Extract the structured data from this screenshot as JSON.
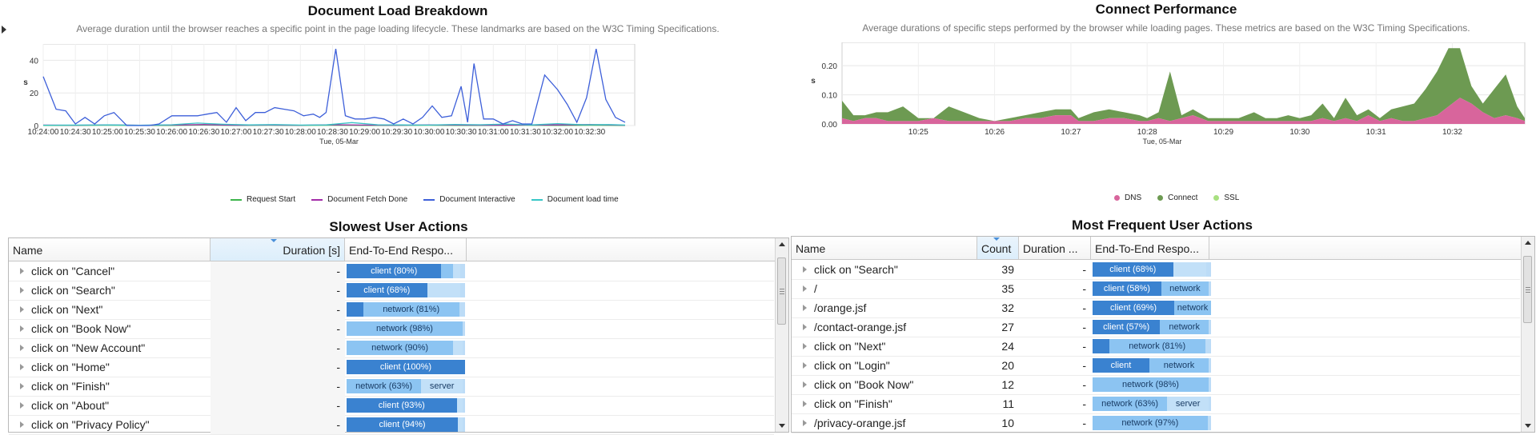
{
  "colors": {
    "request_start": "#3cb44b",
    "document_fetch_done": "#a32ca8",
    "document_interactive": "#3d5fd9",
    "document_load_time": "#37c6c6",
    "dns": "#d8659c",
    "connect": "#6d9a52",
    "ssl": "#a8e080",
    "bar_dark": "#3a82d0",
    "bar_mid": "#8cc4f2"
  },
  "panels": {
    "load": {
      "title": "Document Load Breakdown",
      "subtitle": "Average duration until the browser reaches a specific point in the page loading lifecycle. These landmarks are based on the W3C Timing Specifications.",
      "legend": [
        "Request Start",
        "Document Fetch Done",
        "Document Interactive",
        "Document load time"
      ]
    },
    "connect": {
      "title": "Connect Performance",
      "subtitle": "Average durations of specific steps performed by the browser while loading pages. These metrics are based on the W3C Timing Specifications.",
      "legend": [
        "DNS",
        "Connect",
        "SSL"
      ]
    },
    "slowest": {
      "title": "Slowest User Actions",
      "columns": [
        "Name",
        "Duration [s]",
        "End-To-End Respo..."
      ],
      "rows": [
        {
          "name": "click on \"Cancel\"",
          "duration": "-",
          "segs": [
            {
              "label": "client (80%)",
              "pct": 80,
              "tone": "dark"
            },
            {
              "label": "",
              "pct": 10,
              "tone": "mid"
            },
            {
              "label": "",
              "pct": 6,
              "tone": "light"
            }
          ]
        },
        {
          "name": "click on \"Search\"",
          "duration": "-",
          "segs": [
            {
              "label": "client (68%)",
              "pct": 68,
              "tone": "dark"
            },
            {
              "label": "",
              "pct": 28,
              "tone": "light"
            }
          ]
        },
        {
          "name": "click on \"Next\"",
          "duration": "-",
          "segs": [
            {
              "label": "",
              "pct": 14,
              "tone": "dark"
            },
            {
              "label": "network (81%)",
              "pct": 81,
              "tone": "mid"
            }
          ]
        },
        {
          "name": "click on \"Book Now\"",
          "duration": "-",
          "segs": [
            {
              "label": "network (98%)",
              "pct": 98,
              "tone": "mid"
            }
          ]
        },
        {
          "name": "click on \"New Account\"",
          "duration": "-",
          "segs": [
            {
              "label": "network (90%)",
              "pct": 90,
              "tone": "mid"
            },
            {
              "label": "",
              "pct": 8,
              "tone": "light"
            }
          ]
        },
        {
          "name": "click on \"Home\"",
          "duration": "-",
          "segs": [
            {
              "label": "client (100%)",
              "pct": 100,
              "tone": "dark"
            }
          ]
        },
        {
          "name": "click on \"Finish\"",
          "duration": "-",
          "segs": [
            {
              "label": "network (63%)",
              "pct": 63,
              "tone": "mid"
            },
            {
              "label": "server",
              "pct": 35,
              "tone": "light"
            }
          ]
        },
        {
          "name": "click on \"About\"",
          "duration": "-",
          "segs": [
            {
              "label": "client (93%)",
              "pct": 93,
              "tone": "dark"
            },
            {
              "label": "",
              "pct": 5,
              "tone": "light"
            }
          ]
        },
        {
          "name": "click on \"Privacy Policy\"",
          "duration": "-",
          "segs": [
            {
              "label": "client (94%)",
              "pct": 94,
              "tone": "dark"
            },
            {
              "label": "",
              "pct": 4,
              "tone": "light"
            }
          ]
        }
      ]
    },
    "frequent": {
      "title": "Most Frequent User Actions",
      "columns": [
        "Name",
        "Count",
        "Duration ...",
        "End-To-End Respo..."
      ],
      "rows": [
        {
          "name": "click on \"Search\"",
          "count": "39",
          "duration": "-",
          "segs": [
            {
              "label": "client (68%)",
              "pct": 68,
              "tone": "dark"
            },
            {
              "label": "",
              "pct": 28,
              "tone": "light"
            }
          ]
        },
        {
          "name": "/",
          "count": "35",
          "duration": "-",
          "segs": [
            {
              "label": "client (58%)",
              "pct": 58,
              "tone": "dark"
            },
            {
              "label": "network",
              "pct": 40,
              "tone": "mid"
            }
          ]
        },
        {
          "name": "/orange.jsf",
          "count": "32",
          "duration": "-",
          "segs": [
            {
              "label": "client (69%)",
              "pct": 69,
              "tone": "dark"
            },
            {
              "label": "network",
              "pct": 31,
              "tone": "mid"
            }
          ]
        },
        {
          "name": "/contact-orange.jsf",
          "count": "27",
          "duration": "-",
          "segs": [
            {
              "label": "client (57%)",
              "pct": 57,
              "tone": "dark"
            },
            {
              "label": "network",
              "pct": 41,
              "tone": "mid"
            }
          ]
        },
        {
          "name": "click on \"Next\"",
          "count": "24",
          "duration": "-",
          "segs": [
            {
              "label": "",
              "pct": 14,
              "tone": "dark"
            },
            {
              "label": "network (81%)",
              "pct": 81,
              "tone": "mid"
            }
          ]
        },
        {
          "name": "click on \"Login\"",
          "count": "20",
          "duration": "-",
          "segs": [
            {
              "label": "client",
              "pct": 48,
              "tone": "dark"
            },
            {
              "label": "network",
              "pct": 50,
              "tone": "mid"
            }
          ]
        },
        {
          "name": "click on \"Book Now\"",
          "count": "12",
          "duration": "-",
          "segs": [
            {
              "label": "network (98%)",
              "pct": 98,
              "tone": "mid"
            }
          ]
        },
        {
          "name": "click on \"Finish\"",
          "count": "11",
          "duration": "-",
          "segs": [
            {
              "label": "network (63%)",
              "pct": 63,
              "tone": "mid"
            },
            {
              "label": "server",
              "pct": 35,
              "tone": "light"
            }
          ]
        },
        {
          "name": "/privacy-orange.jsf",
          "count": "10",
          "duration": "-",
          "segs": [
            {
              "label": "network (97%)",
              "pct": 97,
              "tone": "mid"
            }
          ]
        }
      ]
    }
  },
  "chart_data": [
    {
      "type": "line",
      "title": "Document Load Breakdown",
      "xlabel": "Tue, 05-Mar",
      "ylabel": "s",
      "ylim": [
        0,
        50
      ],
      "yticks": [
        0,
        20,
        40
      ],
      "xticks": [
        "10:24:00",
        "10:24:30",
        "10:25:00",
        "10:25:30",
        "10:26:00",
        "10:26:30",
        "10:27:00",
        "10:27:30",
        "10:28:00",
        "10:28:30",
        "10:29:00",
        "10:29:30",
        "10:30:00",
        "10:30:30",
        "10:31:00",
        "10:31:30",
        "10:32:00",
        "10:32:30"
      ],
      "xlim_minutes": [
        24,
        33.2
      ],
      "grid": true,
      "legend_position": "bottom",
      "series": [
        {
          "name": "Document Interactive",
          "color_key": "document_interactive",
          "x": [
            24.0,
            24.2,
            24.35,
            24.5,
            24.65,
            24.8,
            24.95,
            25.1,
            25.3,
            25.5,
            25.65,
            25.8,
            26.0,
            26.2,
            26.4,
            26.55,
            26.7,
            26.85,
            27.0,
            27.15,
            27.3,
            27.45,
            27.6,
            27.75,
            27.9,
            28.05,
            28.2,
            28.3,
            28.4,
            28.55,
            28.7,
            28.85,
            29.0,
            29.15,
            29.3,
            29.45,
            29.6,
            29.75,
            29.9,
            30.05,
            30.2,
            30.35,
            30.5,
            30.6,
            30.7,
            30.85,
            31.0,
            31.15,
            31.3,
            31.45,
            31.6,
            31.8,
            32.0,
            32.15,
            32.3,
            32.45,
            32.6,
            32.75,
            32.9,
            33.05
          ],
          "y": [
            30,
            10,
            9,
            1,
            5,
            1,
            6,
            8,
            0,
            0,
            0,
            1,
            6,
            6,
            6,
            7,
            8,
            2,
            11,
            3,
            8,
            8,
            11,
            10,
            9,
            6,
            7,
            5,
            8,
            47,
            6,
            4,
            4,
            5,
            4,
            1,
            4,
            1,
            5,
            12,
            5,
            6,
            24,
            2,
            38,
            4,
            4,
            1,
            3,
            1,
            1,
            31,
            22,
            13,
            2,
            17,
            47,
            16,
            5,
            2
          ]
        },
        {
          "name": "Document load time",
          "color_key": "document_load_time",
          "x": [
            24.0,
            24.5,
            25.0,
            25.5,
            26.0,
            26.4,
            26.8,
            27.2,
            27.6,
            28.0,
            28.4,
            28.8,
            29.2,
            29.6,
            30.0,
            30.4,
            30.8,
            31.2,
            31.6,
            32.0,
            32.4,
            32.8,
            33.05
          ],
          "y": [
            0.2,
            0.3,
            0.4,
            0.2,
            0.5,
            1.5,
            0.8,
            0.4,
            0.6,
            0.3,
            0.4,
            1.8,
            0.5,
            0.4,
            0.3,
            0.7,
            0.5,
            0.9,
            0.4,
            1.2,
            0.5,
            0.6,
            0.3
          ]
        },
        {
          "name": "Document Fetch Done",
          "color_key": "document_fetch_done",
          "x": [
            24.0,
            24.5,
            25.0,
            25.5,
            26.0,
            26.5,
            27.0,
            27.5,
            28.0,
            28.5,
            29.0,
            29.5,
            30.0,
            30.5,
            31.0,
            31.5,
            32.0,
            32.5,
            33.05
          ],
          "y": [
            0.3,
            0.2,
            0.4,
            0.2,
            0.3,
            0.6,
            0.2,
            0.3,
            0.2,
            0.5,
            0.3,
            0.2,
            0.4,
            0.3,
            0.2,
            0.3,
            0.4,
            0.6,
            0.2
          ]
        },
        {
          "name": "Request Start",
          "color_key": "request_start",
          "x": [
            24.0,
            24.5,
            25.0,
            25.5,
            26.0,
            26.5,
            27.0,
            27.5,
            28.0,
            28.5,
            29.0,
            29.5,
            30.0,
            30.5,
            31.0,
            31.5,
            32.0,
            32.5,
            33.05
          ],
          "y": [
            0.1,
            0.1,
            0.2,
            0.1,
            0.1,
            0.3,
            0.1,
            0.2,
            0.1,
            0.2,
            0.1,
            0.1,
            0.2,
            0.1,
            0.1,
            0.2,
            0.1,
            0.2,
            0.1
          ]
        }
      ]
    },
    {
      "type": "area",
      "title": "Connect Performance",
      "xlabel": "Tue, 05-Mar",
      "ylabel": "s",
      "ylim": [
        0,
        0.28
      ],
      "yticks": [
        0.0,
        0.1,
        0.2
      ],
      "ytick_labels": [
        "0.00",
        "0.10",
        "0.20"
      ],
      "xticks": [
        "10:25",
        "10:26",
        "10:27",
        "10:28",
        "10:29",
        "10:30",
        "10:31",
        "10:32"
      ],
      "xticks_minutes": [
        25,
        26,
        27,
        28,
        29,
        30,
        31,
        32
      ],
      "xlim_minutes": [
        24.0,
        32.95
      ],
      "grid": true,
      "legend_position": "bottom",
      "stacked": true,
      "x": [
        24.0,
        24.15,
        24.3,
        24.45,
        24.6,
        24.8,
        25.0,
        25.2,
        25.4,
        25.6,
        25.8,
        26.0,
        26.2,
        26.4,
        26.6,
        26.8,
        27.0,
        27.1,
        27.3,
        27.5,
        27.7,
        27.9,
        28.0,
        28.15,
        28.3,
        28.45,
        28.6,
        28.8,
        29.0,
        29.2,
        29.4,
        29.55,
        29.7,
        29.85,
        30.0,
        30.15,
        30.3,
        30.45,
        30.6,
        30.75,
        30.9,
        31.05,
        31.2,
        31.35,
        31.5,
        31.65,
        31.8,
        31.95,
        32.1,
        32.25,
        32.4,
        32.55,
        32.7,
        32.85,
        32.95
      ],
      "series": [
        {
          "name": "DNS",
          "color_key": "dns",
          "values": [
            0.02,
            0.01,
            0.02,
            0.02,
            0.01,
            0.01,
            0.01,
            0.02,
            0.01,
            0.01,
            0.01,
            0.01,
            0.01,
            0.02,
            0.02,
            0.03,
            0.03,
            0.01,
            0.01,
            0.02,
            0.02,
            0.01,
            0.01,
            0.02,
            0.01,
            0.02,
            0.03,
            0.01,
            0.01,
            0.01,
            0.01,
            0.01,
            0.01,
            0.01,
            0.01,
            0.01,
            0.02,
            0.01,
            0.02,
            0.01,
            0.03,
            0.01,
            0.02,
            0.01,
            0.01,
            0.02,
            0.03,
            0.06,
            0.09,
            0.07,
            0.04,
            0.02,
            0.03,
            0.02,
            0.01
          ]
        },
        {
          "name": "Connect",
          "color_key": "connect",
          "values": [
            0.06,
            0.02,
            0.01,
            0.02,
            0.03,
            0.05,
            0.01,
            0.0,
            0.05,
            0.03,
            0.01,
            0.0,
            0.01,
            0.01,
            0.02,
            0.02,
            0.02,
            0.01,
            0.03,
            0.03,
            0.02,
            0.02,
            0.01,
            0.02,
            0.17,
            0.01,
            0.02,
            0.01,
            0.01,
            0.01,
            0.03,
            0.01,
            0.01,
            0.02,
            0.01,
            0.02,
            0.05,
            0.01,
            0.07,
            0.02,
            0.02,
            0.01,
            0.03,
            0.05,
            0.06,
            0.1,
            0.15,
            0.2,
            0.17,
            0.06,
            0.03,
            0.1,
            0.14,
            0.04,
            0.01
          ]
        },
        {
          "name": "SSL",
          "color_key": "ssl",
          "values": [
            0,
            0,
            0,
            0,
            0,
            0,
            0,
            0,
            0,
            0,
            0,
            0,
            0,
            0,
            0,
            0,
            0,
            0,
            0,
            0,
            0,
            0,
            0,
            0,
            0,
            0,
            0,
            0,
            0,
            0,
            0,
            0,
            0,
            0,
            0,
            0,
            0,
            0,
            0,
            0,
            0,
            0,
            0,
            0,
            0,
            0,
            0,
            0,
            0,
            0,
            0,
            0,
            0,
            0,
            0
          ]
        }
      ]
    }
  ]
}
